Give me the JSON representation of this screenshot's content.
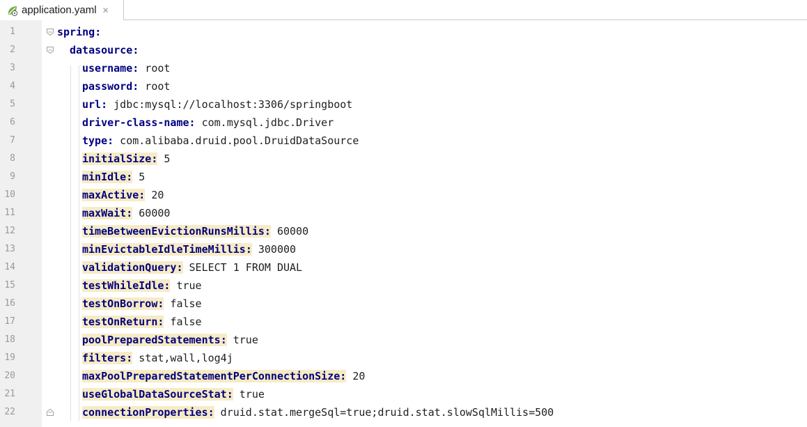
{
  "tab": {
    "filename": "application.yaml",
    "close_glyph": "✕",
    "icon": "spring-leaf-icon"
  },
  "lines": [
    {
      "n": "1",
      "indent": 0,
      "key": "spring",
      "colon": ":",
      "value": "",
      "highlight": false,
      "fold": "open"
    },
    {
      "n": "2",
      "indent": 1,
      "key": "datasource",
      "colon": ":",
      "value": "",
      "highlight": false,
      "fold": "open"
    },
    {
      "n": "3",
      "indent": 2,
      "key": "username",
      "colon": ":",
      "value": " root",
      "highlight": false,
      "fold": ""
    },
    {
      "n": "4",
      "indent": 2,
      "key": "password",
      "colon": ":",
      "value": " root",
      "highlight": false,
      "fold": ""
    },
    {
      "n": "5",
      "indent": 2,
      "key": "url",
      "colon": ":",
      "value": " jdbc:mysql://localhost:3306/springboot",
      "highlight": false,
      "fold": ""
    },
    {
      "n": "6",
      "indent": 2,
      "key": "driver-class-name",
      "colon": ":",
      "value": " com.mysql.jdbc.Driver",
      "highlight": false,
      "fold": ""
    },
    {
      "n": "7",
      "indent": 2,
      "key": "type",
      "colon": ":",
      "value": " com.alibaba.druid.pool.DruidDataSource",
      "highlight": false,
      "fold": ""
    },
    {
      "n": "8",
      "indent": 2,
      "key": "initialSize",
      "colon": ":",
      "value": " 5",
      "highlight": true,
      "fold": ""
    },
    {
      "n": "9",
      "indent": 2,
      "key": "minIdle",
      "colon": ":",
      "value": " 5",
      "highlight": true,
      "fold": ""
    },
    {
      "n": "10",
      "indent": 2,
      "key": "maxActive",
      "colon": ":",
      "value": " 20",
      "highlight": true,
      "fold": ""
    },
    {
      "n": "11",
      "indent": 2,
      "key": "maxWait",
      "colon": ":",
      "value": " 60000",
      "highlight": true,
      "fold": ""
    },
    {
      "n": "12",
      "indent": 2,
      "key": "timeBetweenEvictionRunsMillis",
      "colon": ":",
      "value": " 60000",
      "highlight": true,
      "fold": ""
    },
    {
      "n": "13",
      "indent": 2,
      "key": "minEvictableIdleTimeMillis",
      "colon": ":",
      "value": " 300000",
      "highlight": true,
      "fold": ""
    },
    {
      "n": "14",
      "indent": 2,
      "key": "validationQuery",
      "colon": ":",
      "value": " SELECT 1 FROM DUAL",
      "highlight": true,
      "fold": ""
    },
    {
      "n": "15",
      "indent": 2,
      "key": "testWhileIdle",
      "colon": ":",
      "value": " true",
      "highlight": true,
      "fold": ""
    },
    {
      "n": "16",
      "indent": 2,
      "key": "testOnBorrow",
      "colon": ":",
      "value": " false",
      "highlight": true,
      "fold": ""
    },
    {
      "n": "17",
      "indent": 2,
      "key": "testOnReturn",
      "colon": ":",
      "value": " false",
      "highlight": true,
      "fold": ""
    },
    {
      "n": "18",
      "indent": 2,
      "key": "poolPreparedStatements",
      "colon": ":",
      "value": " true",
      "highlight": true,
      "fold": ""
    },
    {
      "n": "19",
      "indent": 2,
      "key": "filters",
      "colon": ":",
      "value": " stat,wall,log4j",
      "highlight": true,
      "fold": ""
    },
    {
      "n": "20",
      "indent": 2,
      "key": "maxPoolPreparedStatementPerConnectionSize",
      "colon": ":",
      "value": " 20",
      "highlight": true,
      "fold": ""
    },
    {
      "n": "21",
      "indent": 2,
      "key": "useGlobalDataSourceStat",
      "colon": ":",
      "value": " true",
      "highlight": true,
      "fold": ""
    },
    {
      "n": "22",
      "indent": 2,
      "key": "connectionProperties",
      "colon": ":",
      "value": " druid.stat.mergeSql=true;druid.stat.slowSqlMillis=500",
      "highlight": true,
      "fold": "end"
    }
  ],
  "colors": {
    "key": "#000080",
    "key_highlight_bg": "#f6ebc4",
    "gutter_bg": "#f0f0f0",
    "line_number": "#999999",
    "tab_border": "#c9c9c9",
    "spring_icon": "#6db33f"
  }
}
